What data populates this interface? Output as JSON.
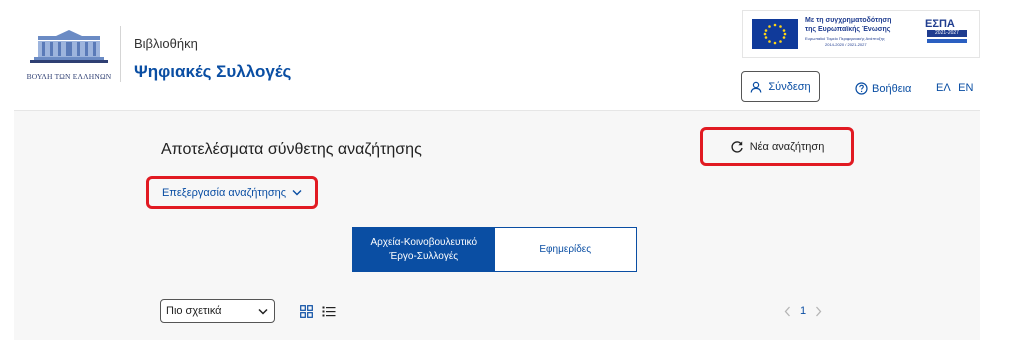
{
  "header": {
    "logo_text": "ΒΟΥΛΗ ΤΩΝ ΕΛΛΗΝΩΝ",
    "site_subtitle": "Βιβλιοθήκη",
    "site_title": "Ψηφιακές Συλλογές",
    "espa": {
      "line1": "Με τη συγχρηματοδότηση",
      "line2": "της Ευρωπαϊκής Ένωσης",
      "line3": "Ευρωπαϊκό Ταμείο Περιφερειακής Ανάπτυξης",
      "line4": "2014-2020 / 2021-2027",
      "logo": "ΕΣΠΑ",
      "years": "2021-2027"
    },
    "login_label": "Σύνδεση",
    "help_label": "Βοήθεια",
    "lang_el": "ΕΛ",
    "lang_en": "EN"
  },
  "main": {
    "results_title": "Αποτελέσματα σύνθετης αναζήτησης",
    "new_search_label": "Νέα αναζήτηση",
    "edit_search_label": "Επεξεργασία αναζήτησης",
    "tabs": [
      {
        "line1": "Αρχεία-Κοινοβουλευτικό",
        "line2": "Έργο-Συλλογές",
        "active": true
      },
      {
        "line1": "Εφημερίδες",
        "line2": "",
        "active": false
      }
    ],
    "sort_selected": "Πιο σχετικά",
    "pagination": {
      "current": "1"
    }
  },
  "colors": {
    "brand": "#0a4ea3",
    "highlight": "#e11a22",
    "background": "#f7f7f7"
  }
}
